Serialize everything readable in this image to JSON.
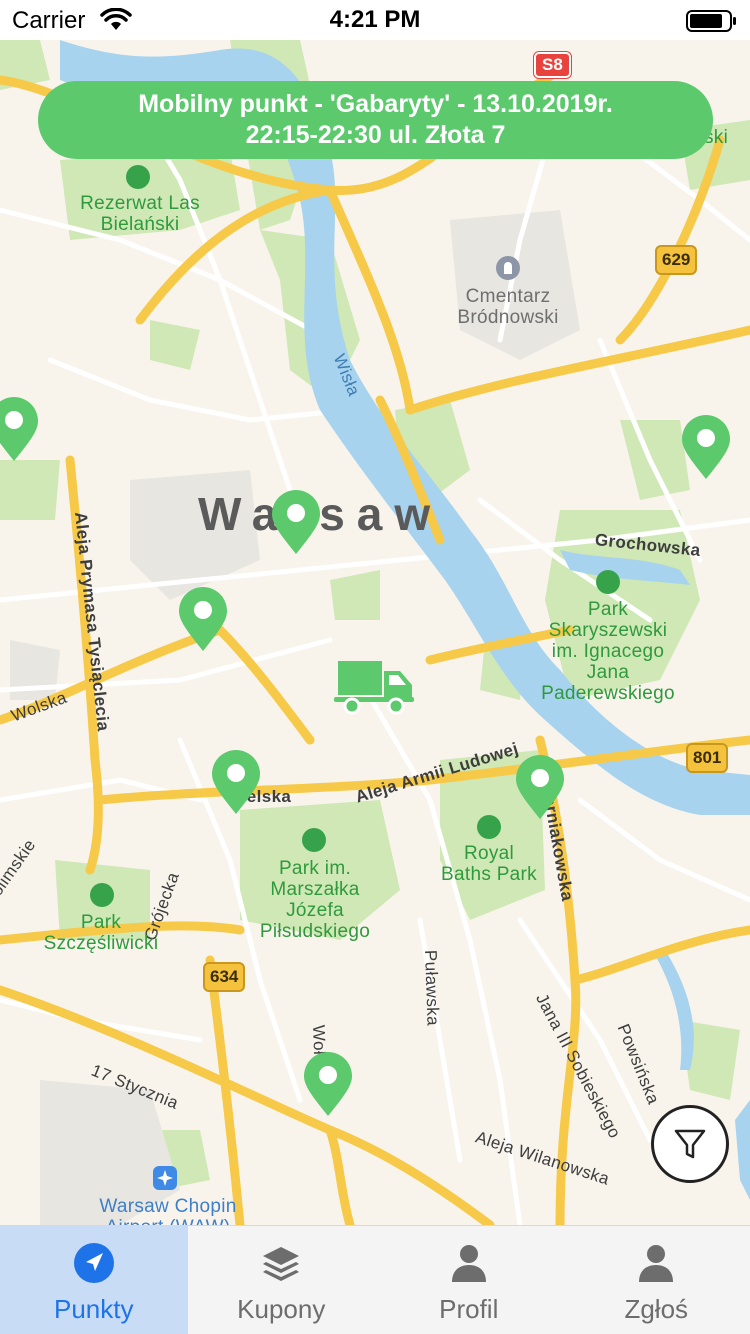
{
  "status_bar": {
    "carrier": "Carrier",
    "time": "4:21 PM"
  },
  "banner": {
    "line1": "Mobilny punkt - 'Gabaryty' - 13.10.2019r.",
    "line2": "22:15-22:30 ul. Złota 7"
  },
  "map": {
    "city": "Warsaw",
    "parks": [
      {
        "id": "rezerwat",
        "label": "Rezerwat Las\nBielański"
      },
      {
        "id": "skaryszewski",
        "label": "Park\nSkaryszewski\nim. Ignacego\nJana\nPaderewskiego"
      },
      {
        "id": "royal",
        "label": "Royal\nBaths Park"
      },
      {
        "id": "pilsudski",
        "label": "Park im.\nMarszałka\nJózefa\nPiłsudskiego"
      },
      {
        "id": "szczesliwicki",
        "label": "Park\nSzczęśliwicki"
      }
    ],
    "places": {
      "cemetery": "Cmentarz\nBródnowski",
      "airport": "Warsaw Chopin\nAirport (WAW)"
    },
    "streets": {
      "wisla": "Wisła",
      "grochowska": "Grochowska",
      "aleja_prymasa": "Aleja Prymasa Tysiąclecia",
      "wolska": "Wolska",
      "jerozolimskie": "Jerozolimskie",
      "grojecka": "Grójecka",
      "armii_ludowej": "Aleja Armii Ludowej",
      "czerniakowska": "Czerniakowska",
      "pulawska": "Puławska",
      "jana_sobieskiego": "Jana III Sobieskiego",
      "powsinska": "Powsińska",
      "wilanowska": "Aleja Wilanowska",
      "17_stycznia": "17 Stycznia",
      "woloska": "Wołoska",
      "rakowiecka": "wielska"
    },
    "road_shields": {
      "s8": "S8",
      "r629": "629",
      "r801": "801",
      "r634": "634"
    },
    "partial_park_label": "ski"
  },
  "tabs": [
    {
      "label": "Punkty",
      "icon": "location-arrow-icon",
      "active": true
    },
    {
      "label": "Kupony",
      "icon": "layers-icon",
      "active": false
    },
    {
      "label": "Profil",
      "icon": "person-icon",
      "active": false
    },
    {
      "label": "Zgłoś",
      "icon": "person-icon",
      "active": false
    }
  ],
  "colors": {
    "accent": "#5cc96d",
    "tab_active_bg": "#c8dcf5",
    "tab_active_text": "#1e73e8",
    "water": "#a7d3ef",
    "park": "#cfe8b6",
    "road_major": "#f7c948"
  }
}
